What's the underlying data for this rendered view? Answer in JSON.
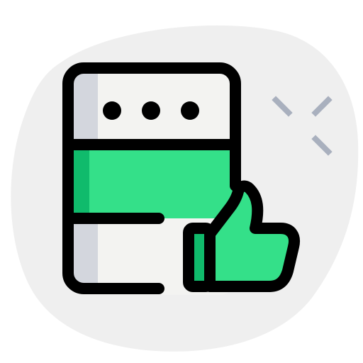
{
  "icon": {
    "name": "server-thumbs-up-icon",
    "parts": [
      "background-blob",
      "server-body",
      "server-dots",
      "server-middle-band",
      "thumbs-up",
      "sparkles"
    ]
  },
  "colors": {
    "background_blob": "#efefef",
    "server_fill": "#f3f3f1",
    "server_shadow": "#d3d6dd",
    "band_green": "#34e089",
    "band_green_dark": "#10bb6c",
    "thumb_green": "#34e089",
    "thumb_cuff": "#10bb6c",
    "outline": "#000000",
    "sparkle": "#a9b0be"
  }
}
